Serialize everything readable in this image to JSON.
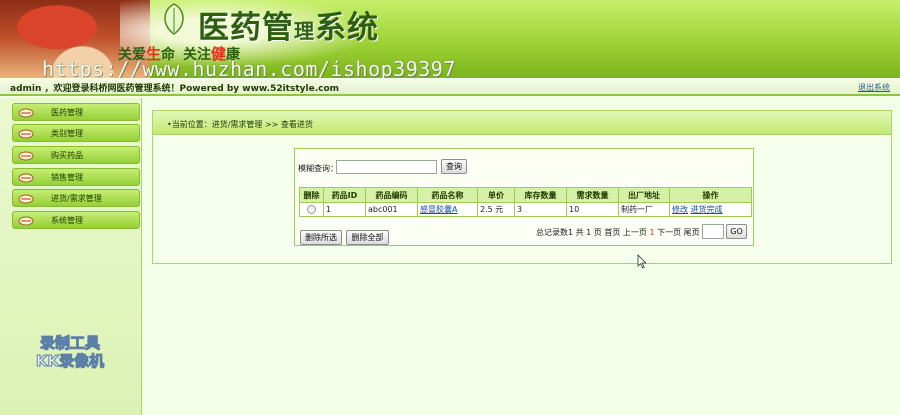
{
  "banner": {
    "title_1": "医药",
    "title_2": "管",
    "title_3": "理",
    "title_4": "系统",
    "slogan_1a": "关爱",
    "slogan_1b": "生",
    "slogan_1c": "命",
    "slogan_2a": "关注",
    "slogan_2b": "健",
    "slogan_2c": "康",
    "watermark": "https://www.huzhan.com/ishop39397"
  },
  "status": {
    "welcome": "admin ，欢迎登录科桥网医药管理系统！Powered by www.52itstyle.com",
    "logout": "退出系统"
  },
  "sidebar": {
    "items": [
      {
        "label": "医药管理"
      },
      {
        "label": "类别管理"
      },
      {
        "label": "购买药品"
      },
      {
        "label": "销售管理"
      },
      {
        "label": "进货/需求管理"
      },
      {
        "label": "系统管理"
      }
    ],
    "recorder_line1": "录制工具",
    "recorder_line2": "KK录像机"
  },
  "main": {
    "breadcrumb": "•当前位置：进货/需求管理 >> 查看进货",
    "search": {
      "label": "模糊查询：",
      "value": "",
      "button": "查询"
    },
    "table": {
      "headers": [
        "删除",
        "药品ID",
        "药品编码",
        "药品名称",
        "单价",
        "库存数量",
        "需求数量",
        "出厂地址",
        "操作"
      ],
      "rows": [
        {
          "id": "1",
          "code": "abc001",
          "name": "感冒胶囊A",
          "price": "2.5 元",
          "stock": "3",
          "demand": "10",
          "factory": "制药一厂",
          "op_edit": "修改",
          "op_stock": "进货完成"
        }
      ]
    },
    "buttons": {
      "delete_selected": "删除所选",
      "delete_all": "删除全部"
    },
    "pager": {
      "prefix": "总记录数1 共 1 页 首页 上一页 ",
      "current": "1",
      "suffix": " 下一页 尾页",
      "go": "GO"
    }
  },
  "colors": {
    "brand_green": "#8cc63f",
    "title_dark_green": "#2c5f10",
    "accent_red": "#e0301e",
    "link_blue": "#1a4fa0"
  }
}
